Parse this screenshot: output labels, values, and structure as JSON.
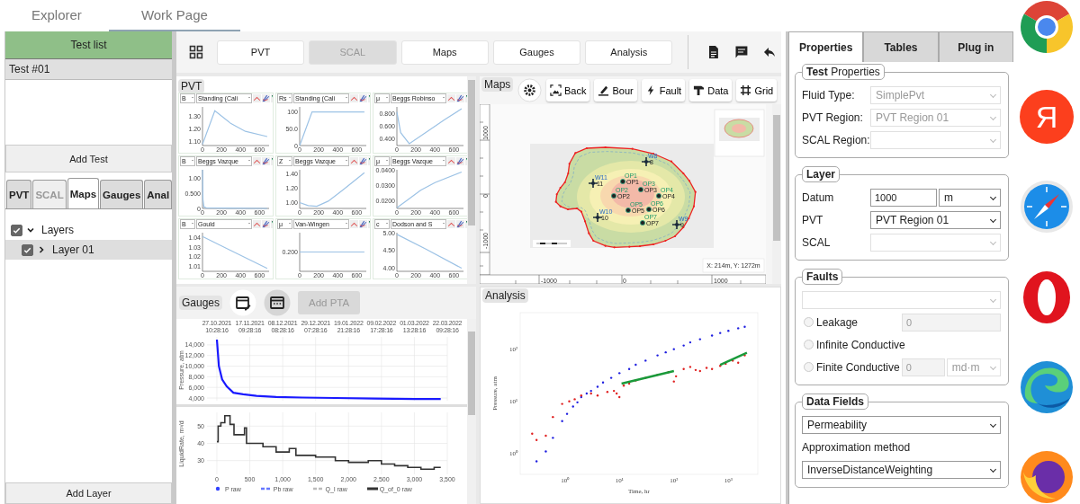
{
  "top_tabs": [
    {
      "label": "Explorer",
      "selected": false
    },
    {
      "label": "Work Page",
      "selected": true
    }
  ],
  "test_list": {
    "title": "Test list",
    "items": [
      {
        "label": "Test #01",
        "selected": true
      }
    ],
    "add_button": "Add Test"
  },
  "left_tabs": [
    {
      "label": "PVT",
      "selected": false,
      "disabled": false
    },
    {
      "label": "SCAL",
      "selected": false,
      "disabled": true
    },
    {
      "label": "Maps",
      "selected": true,
      "disabled": false
    },
    {
      "label": "Gauges",
      "selected": false,
      "disabled": false
    },
    {
      "label": "Anal",
      "selected": false,
      "disabled": false
    }
  ],
  "layers": [
    {
      "label": "Layers",
      "checked": true,
      "expanded": true,
      "selected": false,
      "children": [
        {
          "label": "Layer 01",
          "checked": true,
          "expanded": false,
          "selected": true
        }
      ]
    }
  ],
  "add_layer_button": "Add Layer",
  "toolbar": {
    "buttons": [
      {
        "label": "PVT",
        "disabled": false
      },
      {
        "label": "SCAL",
        "disabled": true
      },
      {
        "label": "Maps",
        "disabled": false
      },
      {
        "label": "Gauges",
        "disabled": false
      },
      {
        "label": "Analysis",
        "disabled": false
      }
    ]
  },
  "pvt": {
    "title": "PVT",
    "plots": [
      {
        "property": "B",
        "correlation": "Standing (Cali",
        "chart_data": {
          "type": "line",
          "x": [
            0,
            130,
            300,
            450,
            680
          ],
          "xlim": [
            0,
            700
          ],
          "ylim": [
            1.07,
            1.37
          ],
          "xticks": [
            0,
            200,
            400,
            600
          ],
          "yticks": [
            {
              "value": 1.1,
              "label": "1.10"
            },
            {
              "value": 1.2,
              "label": "1.20"
            },
            {
              "value": 1.3,
              "label": "1.30"
            }
          ],
          "series": [
            {
              "color": "#9cc2e5",
              "values": [
                1.08,
                1.34,
                1.24,
                1.18,
                1.14
              ]
            }
          ]
        }
      },
      {
        "property": "Rs",
        "correlation": "Standing (Cali",
        "chart_data": {
          "type": "line",
          "x": [
            0,
            130,
            680
          ],
          "xlim": [
            0,
            700
          ],
          "ylim": [
            0,
            115
          ],
          "xticks": [
            0,
            200,
            400,
            600
          ],
          "yticks": [
            {
              "value": 0,
              "label": "0"
            },
            {
              "value": 50,
              "label": "50.0"
            },
            {
              "value": 100,
              "label": "100"
            }
          ],
          "series": [
            {
              "color": "#9cc2e5",
              "values": [
                0,
                100,
                100
              ]
            }
          ]
        }
      },
      {
        "property": "μ",
        "correlation": "Beggs Robinso",
        "chart_data": {
          "type": "line",
          "x": [
            0,
            40,
            130,
            300,
            500,
            680
          ],
          "xlim": [
            0,
            700
          ],
          "ylim": [
            0.3,
            0.9
          ],
          "xticks": [
            0,
            200,
            400,
            600
          ],
          "yticks": [
            {
              "value": 0.4,
              "label": "0.400"
            },
            {
              "value": 0.6,
              "label": "0.600"
            },
            {
              "value": 0.8,
              "label": "0.800"
            }
          ],
          "series": [
            {
              "color": "#9cc2e5",
              "values": [
                0.82,
                0.5,
                0.33,
                0.5,
                0.7,
                0.87
              ]
            }
          ]
        }
      },
      {
        "property": "B",
        "correlation": "Beggs Vazque",
        "chart_data": {
          "type": "line",
          "x": [
            0,
            5,
            15,
            40,
            680
          ],
          "xlim": [
            0,
            700
          ],
          "ylim": [
            0,
            1.3
          ],
          "xticks": [
            0,
            200,
            400,
            600
          ],
          "yticks": [
            {
              "value": 0,
              "label": "0"
            },
            {
              "value": 0.5,
              "label": "0.500"
            },
            {
              "value": 1,
              "label": "1.00"
            }
          ],
          "series": [
            {
              "color": "#9cc2e5",
              "values": [
                1.3,
                0.3,
                0.05,
                0.02,
                0
              ]
            }
          ]
        }
      },
      {
        "property": "Z",
        "correlation": "Beggs Vazque",
        "chart_data": {
          "type": "line",
          "x": [
            0,
            90,
            180,
            300,
            450,
            680
          ],
          "xlim": [
            0,
            700
          ],
          "ylim": [
            0.92,
            1.45
          ],
          "xticks": [
            0,
            200,
            400,
            600
          ],
          "yticks": [
            {
              "value": 1,
              "label": "1.00"
            },
            {
              "value": 1.2,
              "label": "1.20"
            },
            {
              "value": 1.4,
              "label": "1.40"
            }
          ],
          "series": [
            {
              "color": "#9cc2e5",
              "values": [
                1.0,
                0.96,
                0.95,
                1.02,
                1.17,
                1.41
              ]
            }
          ]
        }
      },
      {
        "property": "μ",
        "correlation": "Beggs Vazque",
        "chart_data": {
          "type": "line",
          "x": [
            0,
            100,
            250,
            400,
            680
          ],
          "xlim": [
            0,
            700
          ],
          "ylim": [
            0.015,
            0.0405
          ],
          "xticks": [
            0,
            200,
            400,
            600
          ],
          "yticks": [
            {
              "value": 0.02,
              "label": "0.0200"
            },
            {
              "value": 0.03,
              "label": "0.0300"
            },
            {
              "value": 0.04,
              "label": "0.0400"
            }
          ],
          "series": [
            {
              "color": "#9cc2e5",
              "values": [
                0.0155,
                0.02,
                0.027,
                0.032,
                0.039
              ]
            }
          ]
        }
      },
      {
        "property": "B",
        "correlation": "Gould",
        "chart_data": {
          "type": "line",
          "x": [
            0,
            680
          ],
          "xlim": [
            0,
            700
          ],
          "ylim": [
            1.005,
            1.045
          ],
          "xticks": [
            0,
            200,
            400,
            600
          ],
          "yticks": [
            {
              "value": 1.01,
              "label": "1.01"
            },
            {
              "value": 1.02,
              "label": "1.02"
            },
            {
              "value": 1.03,
              "label": "1.03"
            },
            {
              "value": 1.04,
              "label": "1.04"
            }
          ],
          "series": [
            {
              "color": "#9cc2e5",
              "values": [
                1.041,
                1.008
              ]
            }
          ]
        }
      },
      {
        "property": "μ",
        "correlation": "Van-Wingen",
        "value_label": "0.200",
        "x_tick_labels": [
          "0",
          "200",
          "400",
          "600"
        ]
      },
      {
        "property": "c",
        "correlation": "Dodson and S",
        "chart_data": {
          "type": "line",
          "x": [
            0,
            300,
            680
          ],
          "xlim": [
            0,
            700
          ],
          "ylim": [
            3.9,
            5.02
          ],
          "xticks": [
            0,
            200,
            400,
            600
          ],
          "yticks": [
            {
              "value": 4,
              "label": "4.00"
            },
            {
              "value": 4.5,
              "label": "4.50"
            },
            {
              "value": 5,
              "label": "5.00"
            }
          ],
          "series": [
            {
              "color": "#9cc2e5",
              "values": [
                4.97,
                4.55,
                3.99
              ]
            }
          ]
        }
      }
    ]
  },
  "maps": {
    "title": "Maps",
    "tools": [
      {
        "label": "Back",
        "kind": "image"
      },
      {
        "label": "Bour",
        "kind": "pen"
      },
      {
        "label": "Fault",
        "kind": "bolt"
      },
      {
        "label": "Data",
        "kind": "hammer"
      },
      {
        "label": "Grid",
        "kind": "grid"
      }
    ],
    "wells": [
      {
        "name": "W8",
        "tag": "8",
        "kind": "injector"
      },
      {
        "name": "W11",
        "tag": "11",
        "kind": "injector"
      },
      {
        "name": "OP1",
        "tag": "OP1",
        "kind": "producer"
      },
      {
        "name": "OP3",
        "tag": "OP3",
        "kind": "producer"
      },
      {
        "name": "OP2",
        "tag": "OP2",
        "kind": "producer"
      },
      {
        "name": "OP4",
        "tag": "OP4",
        "kind": "producer"
      },
      {
        "name": "OP5",
        "tag": "OP5",
        "kind": "producer"
      },
      {
        "name": "OP6",
        "tag": "OP6",
        "kind": "producer"
      },
      {
        "name": "W10",
        "tag": "10",
        "kind": "injector"
      },
      {
        "name": "OP7",
        "tag": "OP7",
        "kind": "producer"
      },
      {
        "name": "W9",
        "tag": "9",
        "kind": "injector"
      }
    ],
    "y_ruler": [
      "1000",
      "0",
      "-1000"
    ],
    "x_ruler": [
      "-1000",
      "0",
      "1000"
    ],
    "cursor_readout": "X: 214m, Y: 1272m"
  },
  "gauges": {
    "title": "Gauges",
    "add_button": {
      "label": "Add PTA",
      "disabled": true
    },
    "date_labels": [
      {
        "date": "27.10.2021",
        "time": "10:28:16"
      },
      {
        "date": "17.11.2021",
        "time": "09:28:16"
      },
      {
        "date": "08.12.2021",
        "time": "08:28:16"
      },
      {
        "date": "29.12.2021",
        "time": "07:28:16"
      },
      {
        "date": "19.01.2022",
        "time": "21:28:16"
      },
      {
        "date": "09.02.2022",
        "time": "17:28:16"
      },
      {
        "date": "01.03.2022",
        "time": "13:28:16"
      },
      {
        "date": "22.03.2022",
        "time": "09:28:16"
      }
    ],
    "pressure_chart": {
      "chart_data": {
        "type": "line",
        "ylabel": "Pressure, atm",
        "grid": true,
        "x": [
          0,
          30,
          80,
          150,
          250,
          400,
          600,
          900,
          1300,
          1800,
          2400,
          3000,
          3400
        ],
        "xlim": [
          -150,
          3500
        ],
        "ylim": [
          3500,
          15500
        ],
        "yticks": [
          {
            "value": 4000,
            "label": "4,000"
          },
          {
            "value": 6000,
            "label": "6,000"
          },
          {
            "value": 8000,
            "label": "8,000"
          },
          {
            "value": 10000,
            "label": "10,000"
          },
          {
            "value": 12000,
            "label": "12,000"
          },
          {
            "value": 14000,
            "label": "14,000"
          }
        ],
        "series": [
          {
            "color": "#1a1aff",
            "values": [
              15000,
              10000,
              7500,
              6200,
              5000,
              4700,
              4400,
              4200,
              4100,
              4000,
              3900,
              3800,
              3800
            ]
          }
        ]
      }
    },
    "rate_chart": {
      "chart_data": {
        "type": "line",
        "ylabel": "LiquidRate, m³/d",
        "grid": true,
        "x": [
          0,
          20,
          20,
          60,
          60,
          120,
          120,
          200,
          200,
          260,
          260,
          420,
          420,
          450,
          450,
          700,
          700,
          900,
          900,
          1100,
          1100,
          1200,
          1200,
          1500,
          1500,
          1800,
          1800,
          2000,
          2000,
          2300,
          2300,
          2500,
          2500,
          2700,
          2700,
          2900,
          2900,
          3100,
          3100,
          3300,
          3300,
          3400
        ],
        "xlim": [
          -150,
          3500
        ],
        "ylim": [
          22,
          58
        ],
        "xticks": [
          0,
          500,
          {
            "value": 1000,
            "label": "1,000"
          },
          {
            "value": 1500,
            "label": "1,500"
          },
          {
            "value": 2000,
            "label": "2,000"
          },
          {
            "value": 2500,
            "label": "2,500"
          },
          {
            "value": 3000,
            "label": "3,000"
          },
          {
            "value": 3500,
            "label": "3,500"
          }
        ],
        "yticks": [
          30,
          40,
          50
        ],
        "series": [
          {
            "color": "#333333",
            "values": [
              41,
              41,
              50,
              50,
              52,
              52,
              56,
              56,
              51,
              51,
              45,
              45,
              49,
              49,
              40,
              40,
              38,
              38,
              35,
              35,
              37,
              37,
              33,
              33,
              32,
              32,
              30,
              30,
              29,
              29,
              30,
              30,
              28,
              28,
              27,
              27,
              26,
              26,
              25,
              25,
              26,
              26
            ]
          }
        ]
      }
    },
    "legend": [
      {
        "label": "P raw",
        "color": "#3344ff",
        "kind": "dot"
      },
      {
        "label": "Pb raw",
        "color": "#6677ff",
        "kind": "dash"
      },
      {
        "label": "Q_l raw",
        "color": "#bbbbbb",
        "kind": "dash"
      },
      {
        "label": "Q_of_0 raw",
        "color": "#333333",
        "kind": "line"
      }
    ]
  },
  "analysis": {
    "title": "Analysis",
    "xlabel": "Time, hr",
    "ylabel": "Pressure, atm",
    "x_tick_labels": [
      "10⁰",
      "10¹",
      "10²",
      "10³"
    ],
    "y_tick_labels": [
      "10²",
      "10¹",
      "10⁰"
    ]
  },
  "properties_panel": {
    "tabs": [
      {
        "label": "Properties",
        "selected": true
      },
      {
        "label": "Tables",
        "selected": false
      },
      {
        "label": "Plug in",
        "selected": false
      }
    ],
    "groups": [
      {
        "title": "**Test** Properties",
        "bold": false,
        "rows": [
          {
            "kind": "select",
            "label": "Fluid Type:",
            "value": "SimplePvt",
            "disabled": true
          },
          {
            "kind": "select",
            "label": "PVT Region:",
            "value": "PVT Region 01",
            "disabled": true
          },
          {
            "kind": "select",
            "label": "SCAL Region:",
            "disabled": true
          }
        ]
      },
      {
        "title": "Layer",
        "bold": true,
        "rows": [
          {
            "kind": "number_unit",
            "label": "Datum",
            "value": "1000",
            "unit": "m",
            "disabled": false
          },
          {
            "kind": "select",
            "label": "PVT",
            "value": "PVT Region 01",
            "disabled": false
          },
          {
            "kind": "select",
            "label": "SCAL",
            "disabled": true
          }
        ]
      },
      {
        "title": "Faults",
        "bold": true,
        "rows": [
          {
            "kind": "select_full",
            "disabled": true
          },
          {
            "kind": "radio_input",
            "label": "Leakage",
            "checked": false,
            "value": "0",
            "disabled": true
          },
          {
            "kind": "radio",
            "label": "Infinite Conductive",
            "checked": false
          },
          {
            "kind": "radio_input_unit",
            "label": "Finite Conductive",
            "checked": false,
            "value": "0",
            "unit": "md·m",
            "disabled": true
          }
        ]
      },
      {
        "title": "Data Fields",
        "bold": true,
        "rows": [
          {
            "kind": "select_full",
            "value": "Permeability",
            "disabled": false
          },
          {
            "kind": "caption",
            "label": "Approximation method"
          },
          {
            "kind": "select_full",
            "value": "InverseDistanceWeighting",
            "disabled": false
          }
        ]
      }
    ]
  },
  "side_icons": [
    {
      "kind": "wheel"
    },
    {
      "kind": "letter",
      "text": "Я"
    },
    {
      "kind": "compass"
    },
    {
      "kind": "ring"
    },
    {
      "kind": "wave"
    },
    {
      "kind": "flame"
    }
  ]
}
